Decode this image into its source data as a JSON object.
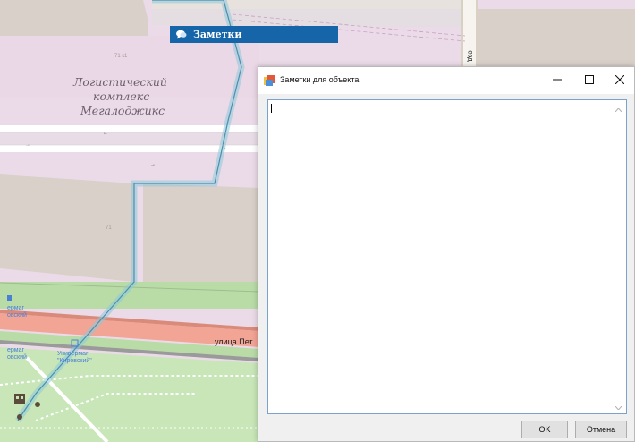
{
  "map": {
    "poi_name": "Логистический комплекс Мегалоджикс",
    "poi_line1": "Логистический",
    "poi_line2": "комплекс",
    "poi_line3": "Мегалоджикс",
    "house_number_top": "71 к1",
    "house_number_mid": "71",
    "street_label": "улица Пет",
    "street_label_right": "езд",
    "store_label_1": "ермаг",
    "store_label_1b": "овский",
    "store_label_2": "ермаг",
    "store_label_2b": "овский",
    "store_label_3": "Универмаг",
    "store_label_3b": "\"Кировский\"",
    "colors": {
      "building": "#d9d0c9",
      "industrial": "#ebdbe8",
      "road": "#ffffff",
      "grass": "#b8dba8",
      "park": "#c8e6b8",
      "red_road": "#f2a495",
      "route": "#8ec8d8"
    }
  },
  "notes_tab": {
    "label": "Заметки",
    "icon": "chat-icon",
    "color": "#1565a8"
  },
  "dialog": {
    "title": "Заметки для объекта",
    "app_icon": "app-icon",
    "minimize_icon": "minimize-icon",
    "maximize_icon": "maximize-icon",
    "close_icon": "close-icon",
    "text_value": "",
    "ok_label": "OK",
    "cancel_label": "Отмена"
  }
}
